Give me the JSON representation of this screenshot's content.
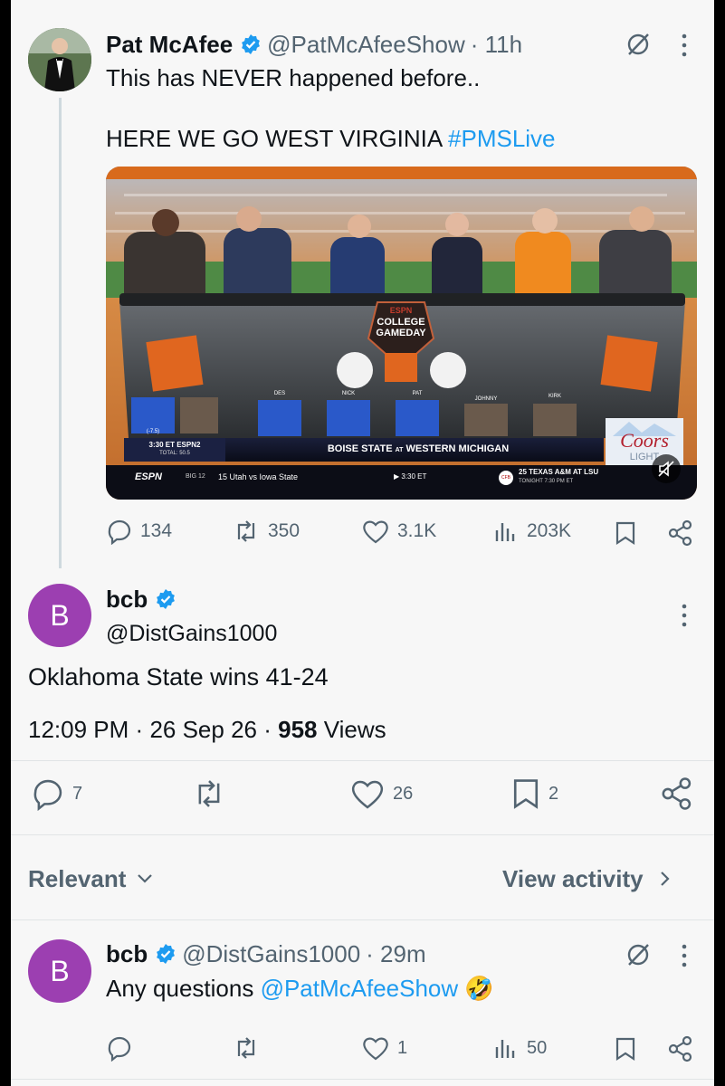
{
  "tweet": {
    "author_name": "Pat McAfee",
    "handle": "@PatMcAfeeShow",
    "time": "· 11h",
    "line1": "This has NEVER happened before..",
    "line2_text": "HERE WE GO WEST VIRGINIA ",
    "hashtag": "#PMSLive",
    "media": {
      "logo_top": "ESPN",
      "logo_title_1": "COLLEGE",
      "logo_title_2": "GAMEDAY",
      "names": [
        "DES",
        "NICK",
        "PAT",
        "JOHNNY",
        "KIRK"
      ],
      "spread": "(-7.5)",
      "time_label": "3:30 ET ESPN2",
      "total": "TOTAL: 50.5",
      "matchup_1": "BOISE STATE",
      "matchup_at": "AT",
      "matchup_2": "WESTERN MICHIGAN",
      "ticker_network": "ESPN",
      "ticker_conf": "BIG 12",
      "ticker_game": "15 Utah vs Iowa State",
      "ticker_time": "▶ 3:30 ET",
      "ticker_cfb": "CFB",
      "ticker_right_1": "25 TEXAS A&M AT LSU",
      "ticker_right_2": "TONIGHT 7:30 PM ET",
      "sponsor_1": "Coors",
      "sponsor_2": "LIGHT"
    },
    "stats": {
      "replies": "134",
      "reposts": "350",
      "likes": "3.1K",
      "views": "203K"
    }
  },
  "focus": {
    "avatar_letter": "B",
    "author_name": "bcb",
    "handle": "@DistGains1000",
    "text": "Oklahoma State wins 41-24",
    "time": "12:09 PM",
    "dot": "·",
    "date": "26 Sep 26",
    "views_count": "958",
    "views_label": " Views",
    "stats": {
      "replies": "7",
      "likes": "26",
      "bookmarks": "2"
    }
  },
  "filter": {
    "relevant_label": "Relevant",
    "activity_label": "View activity"
  },
  "reply": {
    "avatar_letter": "B",
    "author_name": "bcb",
    "handle": "@DistGains1000",
    "time": "· 29m",
    "text": "Any questions ",
    "mention": "@PatMcAfeeShow",
    "emoji": "🤣",
    "stats": {
      "likes": "1",
      "views": "50"
    }
  },
  "colors": {
    "accent": "#1d9bf0",
    "avatar_b": "#9c3fb1",
    "text": "#0f1419",
    "muted": "#536471"
  },
  "icons": [
    "verified-badge-icon",
    "grok-icon",
    "more-icon",
    "reply-icon",
    "repost-icon",
    "like-icon",
    "views-icon",
    "bookmark-icon",
    "share-icon",
    "chevron-down-icon",
    "chevron-right-icon",
    "mute-icon"
  ]
}
